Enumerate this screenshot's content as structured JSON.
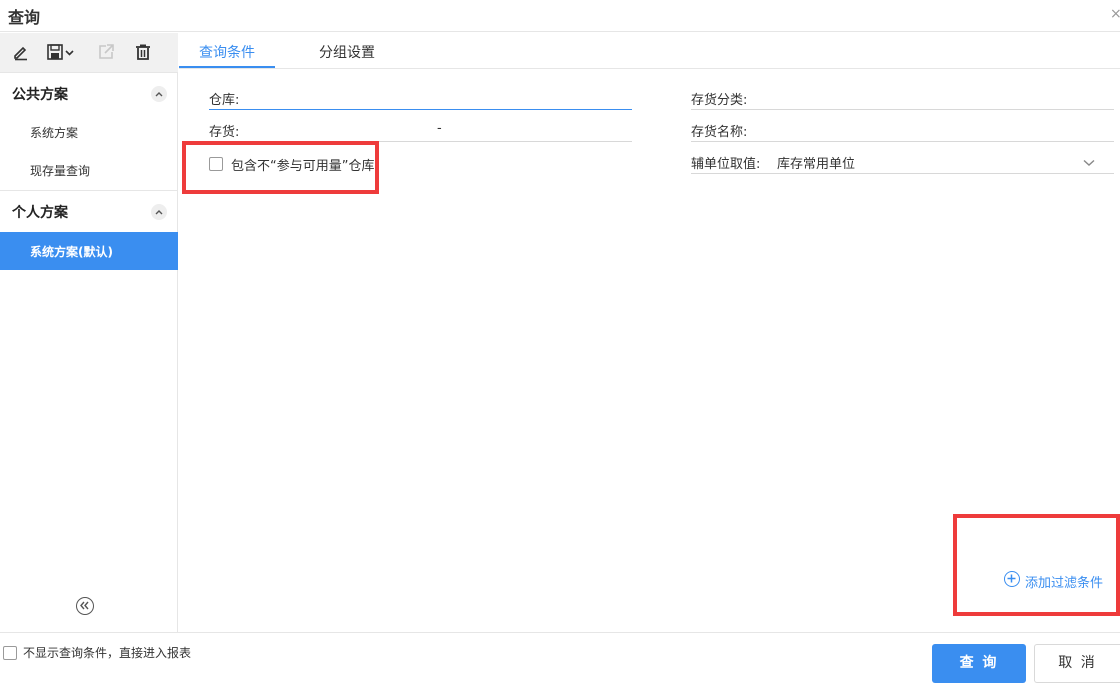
{
  "window": {
    "title": "查询",
    "close_glyph": "×"
  },
  "toolbar": {
    "icons": [
      "edit-icon",
      "save-icon",
      "export-icon",
      "delete-icon"
    ]
  },
  "sidebar": {
    "public_group": {
      "label": "公共方案",
      "items": [
        "系统方案",
        "现存量查询"
      ]
    },
    "personal_group": {
      "label": "个人方案",
      "items": [
        "系统方案(默认)"
      ]
    },
    "active_item": "系统方案(默认)"
  },
  "tabs": [
    {
      "label": "查询条件",
      "active": true
    },
    {
      "label": "分组设置",
      "active": false
    }
  ],
  "form": {
    "warehouse_label": "仓库:",
    "inventory_label": "存货:",
    "inventory_range_sep": "-",
    "include_warehouse_label": "包含不“参与可用量”仓库",
    "include_warehouse_checked": false,
    "inventory_category_label": "存货分类:",
    "inventory_name_label": "存货名称:",
    "aux_unit_label": "辅单位取值:",
    "aux_unit_value": "库存常用单位"
  },
  "add_filter": {
    "label": "添加过滤条件"
  },
  "footer": {
    "skip_conditions_label": "不显示查询条件，直接进入报表",
    "skip_conditions_checked": false,
    "query_button": "查 询",
    "cancel_button": "取 消"
  },
  "colors": {
    "accent": "#3a8ef0",
    "highlight_border": "#ee3b3b"
  }
}
